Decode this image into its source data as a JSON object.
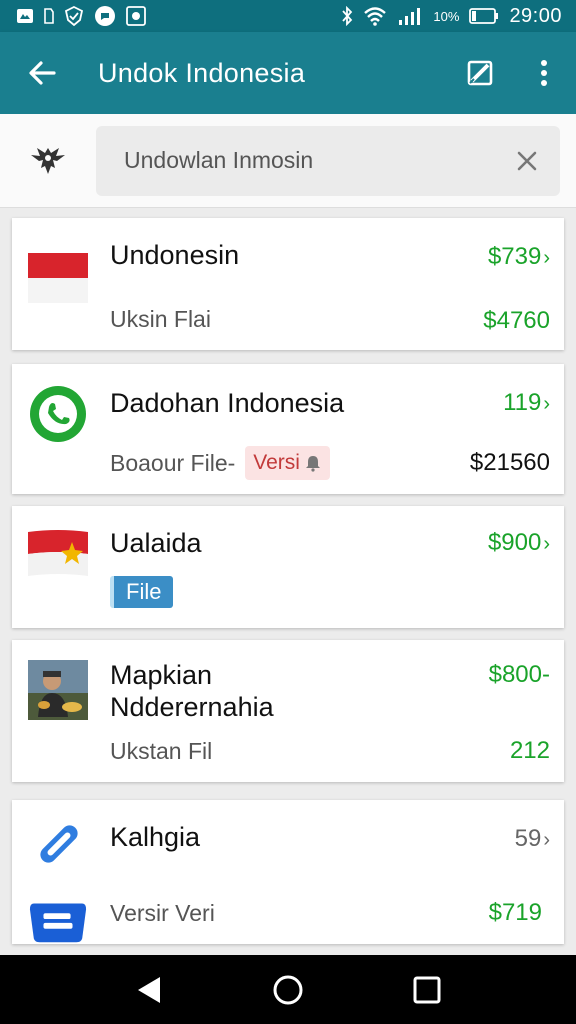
{
  "status_bar": {
    "battery": "10%",
    "time": "29:00",
    "icons_left": [
      "notification-icon",
      "sim-icon",
      "shield-icon",
      "chat-icon",
      "photo-icon"
    ],
    "icons_right": [
      "bluetooth-icon",
      "wifi-icon",
      "signal-icon",
      "battery-icon"
    ]
  },
  "app_bar": {
    "title": "Undok Indonesia",
    "icons": [
      "back-arrow-icon",
      "edit-icon",
      "more-vert-icon"
    ]
  },
  "search": {
    "value": "Undowlan Inmosin",
    "placeholder": "Undowlan Inmosin",
    "icons": [
      "garuda-icon",
      "close-icon"
    ]
  },
  "list": {
    "items": [
      {
        "name": "Undonesin",
        "sub": "Uksin Flai",
        "price_top": "$739",
        "price_bottom": "$4760",
        "thumb": "indonesia-flag-icon"
      },
      {
        "name": "Dadohan Indonesia",
        "sub": "Boaour File-",
        "tag": "Versi",
        "price_top": "119",
        "price_bottom": "$21560",
        "thumb": "whatsapp-icon"
      },
      {
        "name": "Ualaida",
        "tag": "File",
        "price_top": "$900",
        "thumb": "flag-star-icon"
      },
      {
        "name": "Mapkian",
        "name2": "Ndderernahia",
        "sub": "Ukstan Fil",
        "price_top": "$800-",
        "price_bottom": "212",
        "thumb": "person-photo"
      },
      {
        "name": "Kalhgia",
        "sub": "Versir Veri",
        "price_top": "59",
        "price_bottom": "$719",
        "thumb": "paperclip-icon",
        "thumb2": "files-app-icon"
      }
    ]
  },
  "colors": {
    "status_bar": "#0e6f7e",
    "app_bar": "#1a7f8f",
    "price_green": "#1aa32a"
  },
  "nav": {
    "icons": [
      "back-triangle-icon",
      "home-circle-icon",
      "recents-square-icon"
    ]
  }
}
